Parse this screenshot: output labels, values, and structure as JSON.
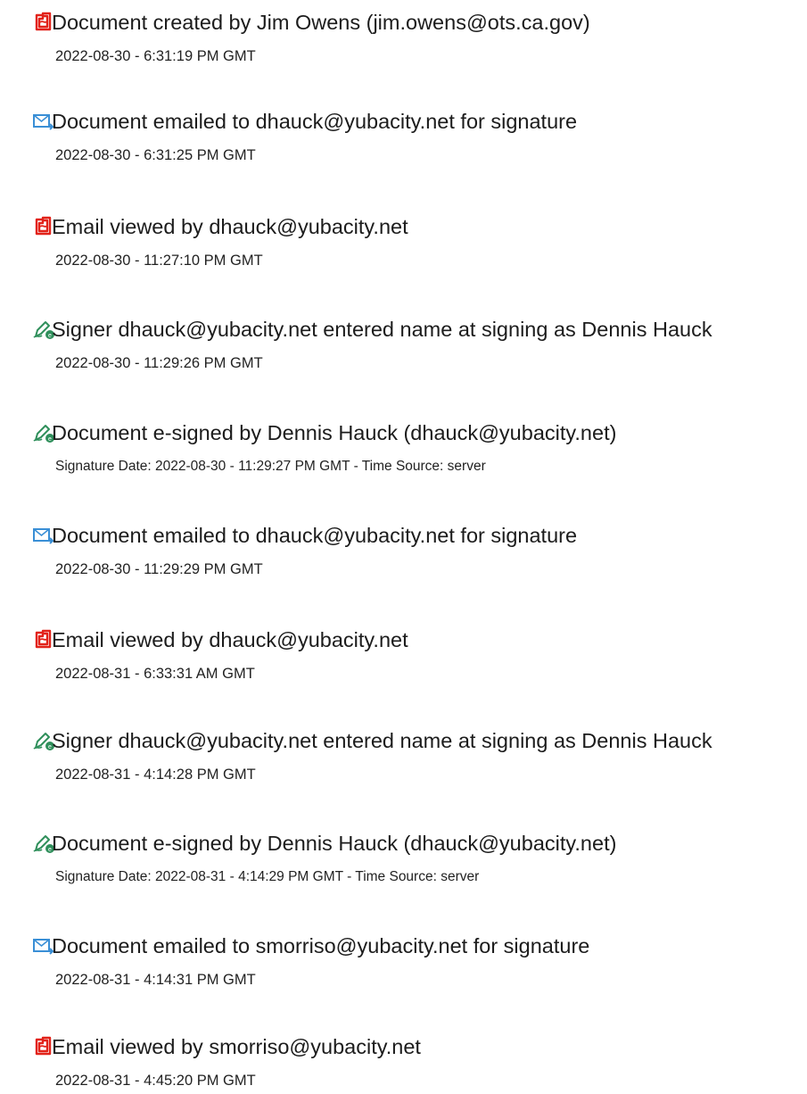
{
  "colors": {
    "pdf_icon": "#e2231a",
    "email_icon": "#3a8fd6",
    "sign_icon": "#2f8f5b"
  },
  "events": [
    {
      "icon": "acrobat-icon",
      "title": "Document created by Jim Owens (jim.owens@ots.ca.gov)",
      "meta": "2022-08-30 - 6:31:19 PM GMT"
    },
    {
      "icon": "email-sent-icon",
      "title": "Document emailed to dhauck@yubacity.net for signature",
      "meta": "2022-08-30 - 6:31:25 PM GMT"
    },
    {
      "icon": "acrobat-icon",
      "title": "Email viewed by dhauck@yubacity.net",
      "meta": "2022-08-30 - 11:27:10 PM GMT"
    },
    {
      "icon": "esign-pen-icon",
      "title": "Signer dhauck@yubacity.net entered name at signing as Dennis Hauck",
      "meta": "2022-08-30 - 11:29:26 PM GMT"
    },
    {
      "icon": "esign-pen-icon",
      "title": "Document e-signed by Dennis Hauck (dhauck@yubacity.net)",
      "meta": "Signature Date: 2022-08-30 - 11:29:27 PM GMT - Time Source: server"
    },
    {
      "icon": "email-sent-icon",
      "title": "Document emailed to dhauck@yubacity.net for signature",
      "meta": "2022-08-30 - 11:29:29 PM GMT"
    },
    {
      "icon": "acrobat-icon",
      "title": "Email viewed by dhauck@yubacity.net",
      "meta": "2022-08-31 - 6:33:31 AM GMT"
    },
    {
      "icon": "esign-pen-icon",
      "title": "Signer dhauck@yubacity.net entered name at signing as Dennis Hauck",
      "meta": "2022-08-31 - 4:14:28 PM GMT"
    },
    {
      "icon": "esign-pen-icon",
      "title": "Document e-signed by Dennis Hauck (dhauck@yubacity.net)",
      "meta": "Signature Date: 2022-08-31 - 4:14:29 PM GMT - Time Source: server"
    },
    {
      "icon": "email-sent-icon",
      "title": "Document emailed to smorriso@yubacity.net for signature",
      "meta": "2022-08-31 - 4:14:31 PM GMT"
    },
    {
      "icon": "acrobat-icon",
      "title": "Email viewed by smorriso@yubacity.net",
      "meta": "2022-08-31 - 4:45:20 PM GMT"
    }
  ]
}
